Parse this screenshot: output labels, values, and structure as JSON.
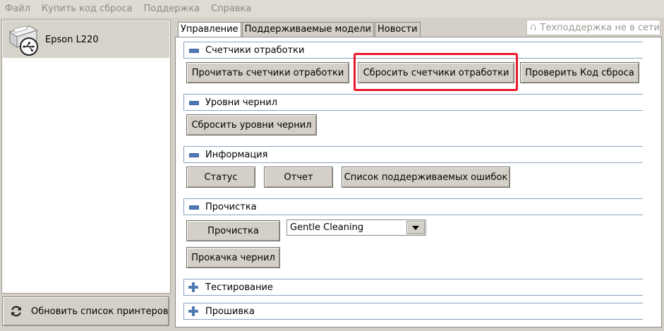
{
  "menu": [
    "Файл",
    "Купить код сброса",
    "Поддержка",
    "Справка"
  ],
  "printers": [
    {
      "name": "Epson L220",
      "icon": "usb-printer-icon"
    }
  ],
  "refresh_button": {
    "label": "Обновить список принтеров",
    "icon": "refresh-icon"
  },
  "tabs": [
    {
      "label": "Управление",
      "active": true
    },
    {
      "label": "Поддерживаемые модели",
      "active": false
    },
    {
      "label": "Новости",
      "active": false
    }
  ],
  "support_status": {
    "label": "Техподдержка не в сети",
    "icon": "headset-icon"
  },
  "sections": {
    "counters": {
      "title": "Счетчики отработки",
      "state": "expanded",
      "buttons": {
        "read": "Прочитать счетчики отработки",
        "reset": "Сбросить счетчики отработки",
        "check": "Проверить Код сброса"
      }
    },
    "ink": {
      "title": "Уровни чернил",
      "state": "expanded",
      "buttons": {
        "reset": "Сбросить уровни чернил"
      }
    },
    "info": {
      "title": "Информация",
      "state": "expanded",
      "buttons": {
        "status": "Статус",
        "report": "Отчет",
        "errors": "Список поддерживаемых ошибок"
      }
    },
    "cleaning": {
      "title": "Прочистка",
      "state": "expanded",
      "buttons": {
        "clean": "Прочистка",
        "flush": "Прокачка чернил"
      },
      "mode_select": {
        "value": "Gentle Cleaning"
      }
    },
    "testing": {
      "title": "Тестирование",
      "state": "collapsed"
    },
    "firmware": {
      "title": "Прошивка",
      "state": "collapsed"
    }
  },
  "colors": {
    "highlight": "#e8192a",
    "section_border": "#8aa2c0",
    "toggle_icon": "#4f79b5"
  }
}
